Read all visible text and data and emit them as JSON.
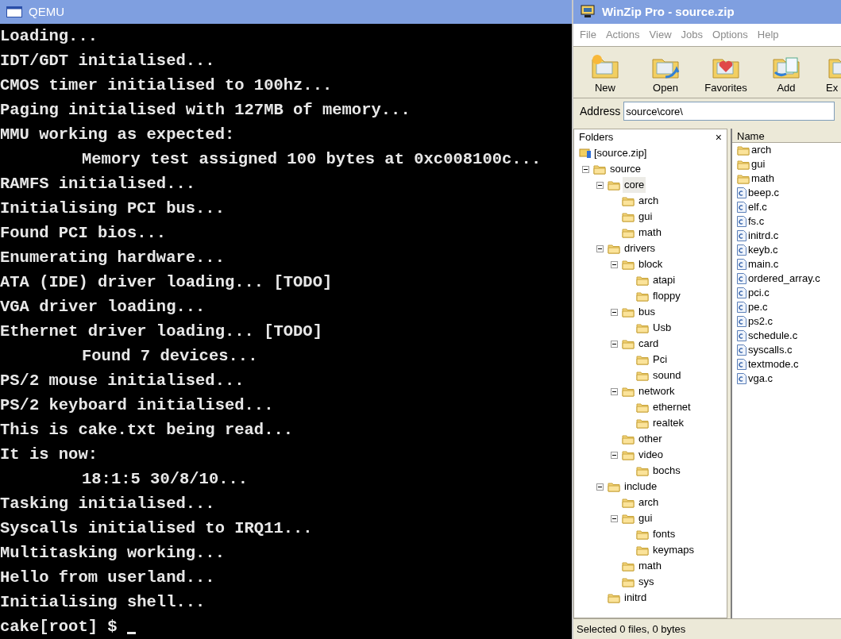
{
  "qemu": {
    "title": "QEMU",
    "lines": [
      {
        "text": "Loading...",
        "indent": false
      },
      {
        "text": "IDT/GDT initialised...",
        "indent": false
      },
      {
        "text": "CMOS timer initialised to 100hz...",
        "indent": false
      },
      {
        "text": "Paging initialised with 127MB of memory...",
        "indent": false
      },
      {
        "text": "MMU working as expected:",
        "indent": false
      },
      {
        "text": "Memory test assigned 100 bytes at 0xc008100c...",
        "indent": true
      },
      {
        "text": "RAMFS initialised...",
        "indent": false
      },
      {
        "text": "Initialising PCI bus...",
        "indent": false
      },
      {
        "text": "Found PCI bios...",
        "indent": false
      },
      {
        "text": "Enumerating hardware...",
        "indent": false
      },
      {
        "text": "ATA (IDE) driver loading... [TODO]",
        "indent": false
      },
      {
        "text": "VGA driver loading...",
        "indent": false
      },
      {
        "text": "Ethernet driver loading... [TODO]",
        "indent": false
      },
      {
        "text": "Found 7 devices...",
        "indent": true
      },
      {
        "text": "PS/2 mouse initialised...",
        "indent": false
      },
      {
        "text": "PS/2 keyboard initialised...",
        "indent": false
      },
      {
        "text": "This is cake.txt being read...",
        "indent": false
      },
      {
        "text": "It is now:",
        "indent": false
      },
      {
        "text": "18:1:5 30/8/10...",
        "indent": true
      },
      {
        "text": "Tasking initialised...",
        "indent": false
      },
      {
        "text": "Syscalls initialised to IRQ11...",
        "indent": false
      },
      {
        "text": "Multitasking working...",
        "indent": false
      },
      {
        "text": "Hello from userland...",
        "indent": false
      },
      {
        "text": "Initialising shell...",
        "indent": false
      }
    ],
    "prompt": "cake[root] $"
  },
  "winzip": {
    "title": "WinZip Pro - source.zip",
    "menu": [
      "File",
      "Actions",
      "View",
      "Jobs",
      "Options",
      "Help"
    ],
    "toolbar": [
      {
        "label": "New",
        "kind": "new"
      },
      {
        "label": "Open",
        "kind": "open"
      },
      {
        "label": "Favorites",
        "kind": "favorites"
      },
      {
        "label": "Add",
        "kind": "add"
      },
      {
        "label": "Ex",
        "kind": "extract"
      }
    ],
    "address": {
      "label": "Address",
      "value": "source\\core\\"
    },
    "folders": {
      "title": "Folders",
      "close": "×",
      "root": "[source.zip]",
      "tree": [
        {
          "name": "source",
          "expanded": true,
          "selected": false,
          "children": [
            {
              "name": "core",
              "expanded": true,
              "selected": true,
              "children": [
                {
                  "name": "arch",
                  "selected": false
                },
                {
                  "name": "gui",
                  "selected": false
                },
                {
                  "name": "math",
                  "selected": false
                }
              ]
            },
            {
              "name": "drivers",
              "expanded": true,
              "selected": false,
              "children": [
                {
                  "name": "block",
                  "expanded": true,
                  "selected": false,
                  "children": [
                    {
                      "name": "atapi",
                      "selected": false
                    },
                    {
                      "name": "floppy",
                      "selected": false
                    }
                  ]
                },
                {
                  "name": "bus",
                  "expanded": true,
                  "selected": false,
                  "children": [
                    {
                      "name": "Usb",
                      "selected": false
                    }
                  ]
                },
                {
                  "name": "card",
                  "expanded": true,
                  "selected": false,
                  "children": [
                    {
                      "name": "Pci",
                      "selected": false
                    },
                    {
                      "name": "sound",
                      "selected": false
                    }
                  ]
                },
                {
                  "name": "network",
                  "expanded": true,
                  "selected": false,
                  "children": [
                    {
                      "name": "ethernet",
                      "selected": false
                    },
                    {
                      "name": "realtek",
                      "selected": false
                    }
                  ]
                },
                {
                  "name": "other",
                  "selected": false
                },
                {
                  "name": "video",
                  "expanded": true,
                  "selected": false,
                  "children": [
                    {
                      "name": "bochs",
                      "selected": false
                    }
                  ]
                }
              ]
            },
            {
              "name": "include",
              "expanded": true,
              "selected": false,
              "children": [
                {
                  "name": "arch",
                  "selected": false
                },
                {
                  "name": "gui",
                  "expanded": true,
                  "selected": false,
                  "children": [
                    {
                      "name": "fonts",
                      "selected": false
                    },
                    {
                      "name": "keymaps",
                      "selected": false
                    }
                  ]
                },
                {
                  "name": "math",
                  "selected": false
                },
                {
                  "name": "sys",
                  "selected": false
                }
              ]
            },
            {
              "name": "initrd",
              "selected": false
            }
          ]
        }
      ]
    },
    "files": {
      "column": "Name",
      "items": [
        {
          "name": "arch",
          "kind": "folder"
        },
        {
          "name": "gui",
          "kind": "folder"
        },
        {
          "name": "math",
          "kind": "folder"
        },
        {
          "name": "beep.c",
          "kind": "file"
        },
        {
          "name": "elf.c",
          "kind": "file"
        },
        {
          "name": "fs.c",
          "kind": "file"
        },
        {
          "name": "initrd.c",
          "kind": "file"
        },
        {
          "name": "keyb.c",
          "kind": "file"
        },
        {
          "name": "main.c",
          "kind": "file"
        },
        {
          "name": "ordered_array.c",
          "kind": "file"
        },
        {
          "name": "pci.c",
          "kind": "file"
        },
        {
          "name": "pe.c",
          "kind": "file"
        },
        {
          "name": "ps2.c",
          "kind": "file"
        },
        {
          "name": "schedule.c",
          "kind": "file"
        },
        {
          "name": "syscalls.c",
          "kind": "file"
        },
        {
          "name": "textmode.c",
          "kind": "file"
        },
        {
          "name": "vga.c",
          "kind": "file"
        }
      ]
    },
    "status": "Selected 0 files, 0 bytes"
  }
}
